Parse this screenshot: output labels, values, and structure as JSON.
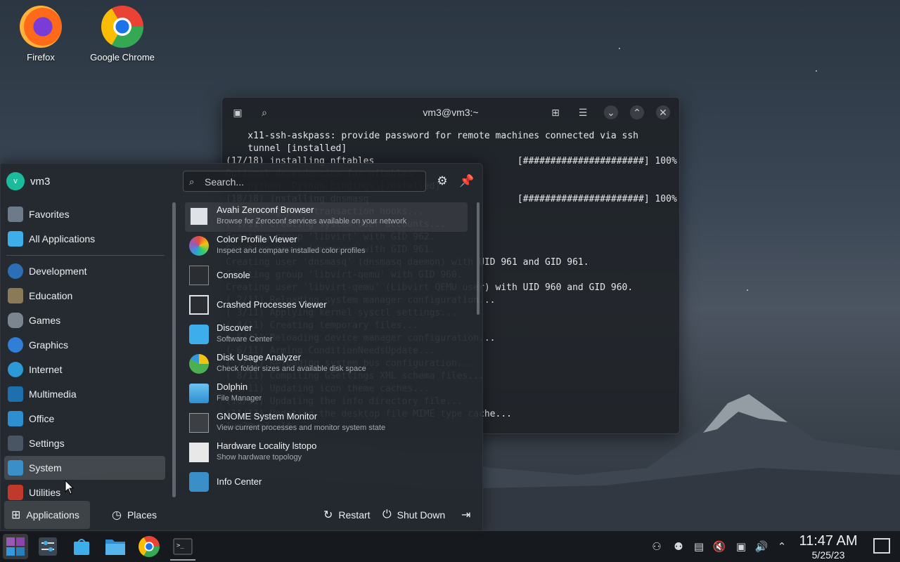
{
  "desktop": {
    "icons": [
      {
        "label": "Firefox",
        "icon": "firefox-icon"
      },
      {
        "label": "Google Chrome",
        "icon": "chrome-icon"
      }
    ]
  },
  "terminal": {
    "title": "vm3@vm3:~",
    "lines": [
      "    x11-ssh-askpass: provide password for remote machines connected via ssh",
      "    tunnel [installed]",
      "(17/18) installing nftables                          [######################] 100%",
      "Optional dependencies for nftables",
      "    python: Python bindings [installed]",
      "(18/18) installing dnsmasq                           [######################] 100%",
      ":: Running post-transaction hooks...",
      "( 1/11) Creating system user accounts...",
      "Creating group 'libvirt' with GID 962.",
      "Creating group 'dnsmasq' with GID 961.",
      "Creating user 'dnsmasq' (dnsmasq daemon) with UID 961 and GID 961.",
      "Creating group 'libvirt-qemu' with GID 960.",
      "Creating user 'libvirt-qemu' (Libvirt QEMU user) with UID 960 and GID 960.",
      "( 2/11) Reloading system manager configuration...",
      "( 3/11) Applying kernel sysctl settings...",
      "( 4/11) Creating temporary files...",
      "( 5/11) Reloading device manager configuration...",
      "( 6/11) Arming ConditionNeedsUpdate...",
      "( 7/11) Reloading system bus configuration...",
      "( 8/11) Compiling GSettings XML schema files...",
      "( 9/11) Updating icon theme caches...",
      "(10/11) Updating the info directory file...",
      "(11/11) Updating the desktop file MIME type cache...",
      "[vm3@vm3 ~]$ "
    ]
  },
  "launcher": {
    "user": {
      "name": "vm3",
      "initial": "v"
    },
    "search_placeholder": "Search...",
    "categories": [
      {
        "label": "Favorites",
        "icon": "favorites-icon",
        "color": "#6c7a89"
      },
      {
        "label": "All Applications",
        "icon": "all-apps-icon",
        "color": "#3daee9"
      },
      {
        "label": "Development",
        "icon": "development-icon",
        "color": "#2c6fb7"
      },
      {
        "label": "Education",
        "icon": "education-icon",
        "color": "#8a7a58"
      },
      {
        "label": "Games",
        "icon": "games-icon",
        "color": "#7b8590"
      },
      {
        "label": "Graphics",
        "icon": "graphics-icon",
        "color": "#2f7fd6"
      },
      {
        "label": "Internet",
        "icon": "internet-icon",
        "color": "#2b9ad6"
      },
      {
        "label": "Multimedia",
        "icon": "multimedia-icon",
        "color": "#1d6fae"
      },
      {
        "label": "Office",
        "icon": "office-icon",
        "color": "#2e8fd0"
      },
      {
        "label": "Settings",
        "icon": "settings-icon",
        "color": "#4a5563"
      },
      {
        "label": "System",
        "icon": "system-icon",
        "color": "#3a8fc9",
        "selected": true
      },
      {
        "label": "Utilities",
        "icon": "utilities-icon",
        "color": "#c0392b"
      }
    ],
    "apps": [
      {
        "name": "Avahi Zeroconf Browser",
        "desc": "Browse for Zeroconf services available on your network",
        "icon": "avahi-icon",
        "color": "#dfe3e7"
      },
      {
        "name": "Color Profile Viewer",
        "desc": "Inspect and compare installed color profiles",
        "icon": "color-profile-icon",
        "color": "#f1c40f"
      },
      {
        "name": "Console",
        "desc": "",
        "icon": "console-icon",
        "color": "#2a2e33"
      },
      {
        "name": "Crashed Processes Viewer",
        "desc": "",
        "icon": "crash-viewer-icon",
        "color": "#dfe3e7"
      },
      {
        "name": "Discover",
        "desc": "Software Center",
        "icon": "discover-icon",
        "color": "#3daee9"
      },
      {
        "name": "Disk Usage Analyzer",
        "desc": "Check folder sizes and available disk space",
        "icon": "disk-usage-icon",
        "color": "#4caf50"
      },
      {
        "name": "Dolphin",
        "desc": "File Manager",
        "icon": "dolphin-icon",
        "color": "#3ea7e6"
      },
      {
        "name": "GNOME System Monitor",
        "desc": "View current processes and monitor system state",
        "icon": "system-monitor-icon",
        "color": "#3c3f44"
      },
      {
        "name": "Hardware Locality lstopo",
        "desc": "Show hardware topology",
        "icon": "lstopo-icon",
        "color": "#e8e8e8"
      },
      {
        "name": "Info Center",
        "desc": "",
        "icon": "info-center-icon",
        "color": "#3a8fc9"
      }
    ],
    "footer": {
      "applications": "Applications",
      "places": "Places",
      "restart": "Restart",
      "shutdown": "Shut Down"
    }
  },
  "taskbar": {
    "apps": [
      "app-launcher-icon",
      "system-settings-icon",
      "discover-icon",
      "dolphin-icon",
      "chrome-icon",
      "konsole-icon"
    ],
    "clock": {
      "time": "11:47 AM",
      "date": "5/25/23"
    }
  }
}
